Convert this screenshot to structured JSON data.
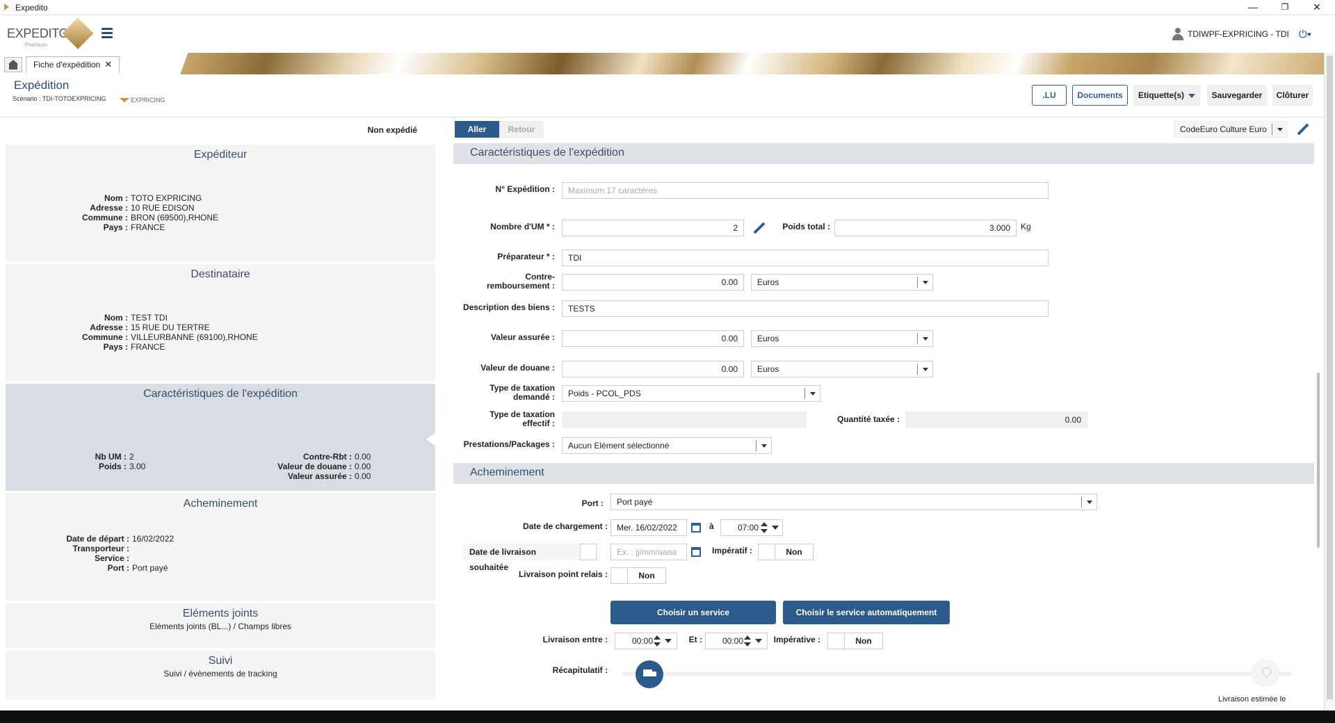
{
  "window": {
    "title": "Expedito",
    "minimize": "—",
    "maximize": "❐",
    "close": "✕"
  },
  "header": {
    "logo": "EXPEDITO",
    "logo_sub": "Premium",
    "user": "TDIWPF-EXPRICING - TDI"
  },
  "tabs": [
    {
      "label": "Fiche d'expédition",
      "close": "✕"
    }
  ],
  "page": {
    "title": "Expédition",
    "scenario": "Scénario : TDI-TOTOEXPRICING",
    "carrier_logo": "EXPRICING",
    "buttons": {
      "lu": ".LU",
      "documents": "Documents",
      "etiquettes": "Etiquette(s)",
      "sauvegarder": "Sauvegarder",
      "cloturer": "Clôturer"
    }
  },
  "left": {
    "status": "Non expédié",
    "expediteur": {
      "title": "Expéditeur",
      "rows": [
        {
          "k": "Nom :",
          "v": "TOTO EXPRICING"
        },
        {
          "k": "Adresse :",
          "v": "10 RUE EDISON"
        },
        {
          "k": "Commune :",
          "v": "BRON (69500),RHONE"
        },
        {
          "k": "Pays :",
          "v": "FRANCE"
        }
      ]
    },
    "destinataire": {
      "title": "Destinataire",
      "rows": [
        {
          "k": "Nom :",
          "v": "TEST TDI"
        },
        {
          "k": "Adresse :",
          "v": "15 RUE DU TERTRE"
        },
        {
          "k": "Commune :",
          "v": "VILLEURBANNE (69100),RHONE"
        },
        {
          "k": "Pays :",
          "v": "FRANCE"
        }
      ]
    },
    "caracteristiques": {
      "title": "Caractéristiques de l'expédition",
      "left_rows": [
        {
          "k": "Nb UM :",
          "v": "2"
        },
        {
          "k": "Poids :",
          "v": "3.00"
        }
      ],
      "right_rows": [
        {
          "k": "Contre-Rbt :",
          "v": "0.00"
        },
        {
          "k": "Valeur de douane :",
          "v": "0.00"
        },
        {
          "k": "Valeur assurée :",
          "v": "0.00"
        }
      ]
    },
    "acheminement": {
      "title": "Acheminement",
      "rows": [
        {
          "k": "Date de départ :",
          "v": "16/02/2022"
        },
        {
          "k": "Transporteur :",
          "v": ""
        },
        {
          "k": "Service :",
          "v": ""
        },
        {
          "k": "Port :",
          "v": "Port payé"
        }
      ]
    },
    "elements": {
      "title": "Eléments joints",
      "subtitle": "Eléments joints (BL...) / Champs libres"
    },
    "suivi": {
      "title": "Suivi",
      "subtitle": "Suivi / évènements de tracking"
    }
  },
  "right": {
    "direction": {
      "aller": "Aller",
      "retour": "Retour"
    },
    "profile": "CodeEuro Culture Euro",
    "section1": "Caractéristiques de l'expédition",
    "fields": {
      "no_expedition": {
        "label": "N° Expédition :",
        "placeholder": "Maximum 17 caractères"
      },
      "nombre_um": {
        "label": "Nombre d'UM * :",
        "value": "2"
      },
      "poids_total": {
        "label": "Poids total :",
        "value": "3.000",
        "unit": "Kg"
      },
      "preparateur": {
        "label": "Préparateur * :",
        "value": "TDI"
      },
      "contre_remb": {
        "label1": "Contre-",
        "label2": "remboursement :",
        "value": "0.00",
        "currency": "Euros"
      },
      "description": {
        "label": "Description des biens :",
        "value": "TESTS"
      },
      "valeur_assuree": {
        "label": "Valeur assurée :",
        "value": "0.00",
        "currency": "Euros"
      },
      "valeur_douane": {
        "label": "Valeur de douane :",
        "value": "0.00",
        "currency": "Euros"
      },
      "taxation_demandee": {
        "label1": "Type de taxation",
        "label2": "demandé :",
        "value": "Poids - PCOL_PDS"
      },
      "taxation_effectif": {
        "label1": "Type de taxation",
        "label2": "effectif :",
        "value": ""
      },
      "quantite_taxee": {
        "label": "Quantité taxée :",
        "value": "0.00"
      },
      "prestations": {
        "label": "Prestations/Packages :",
        "value": "Aucun Elément sélectionné"
      }
    },
    "section2": "Acheminement",
    "ach": {
      "port": {
        "label": "Port :",
        "value": "Port payé"
      },
      "date_chargement": {
        "label": "Date de chargement :",
        "day": "Mer.",
        "date": "16/02/2022",
        "a": "à",
        "time": "07:00"
      },
      "date_livraison": {
        "label": "Date de livraison souhaitée",
        "placeholder": "Ex. : jj/mm/aaaa"
      },
      "imperatif": {
        "label": "Impératif :",
        "value": "Non"
      },
      "point_relais": {
        "label": "Livraison point relais :",
        "value": "Non"
      },
      "btn_service": "Choisir un service",
      "btn_auto": "Choisir le service automatiquement",
      "livraison_entre": {
        "label": "Livraison entre :",
        "from": "00:00",
        "et": "Et :",
        "to": "00:00"
      },
      "imperative": {
        "label": "Impérative :",
        "value": "Non"
      },
      "recap": {
        "label": "Récapitulatif :",
        "estimate": "Livraison estimée le"
      }
    }
  }
}
